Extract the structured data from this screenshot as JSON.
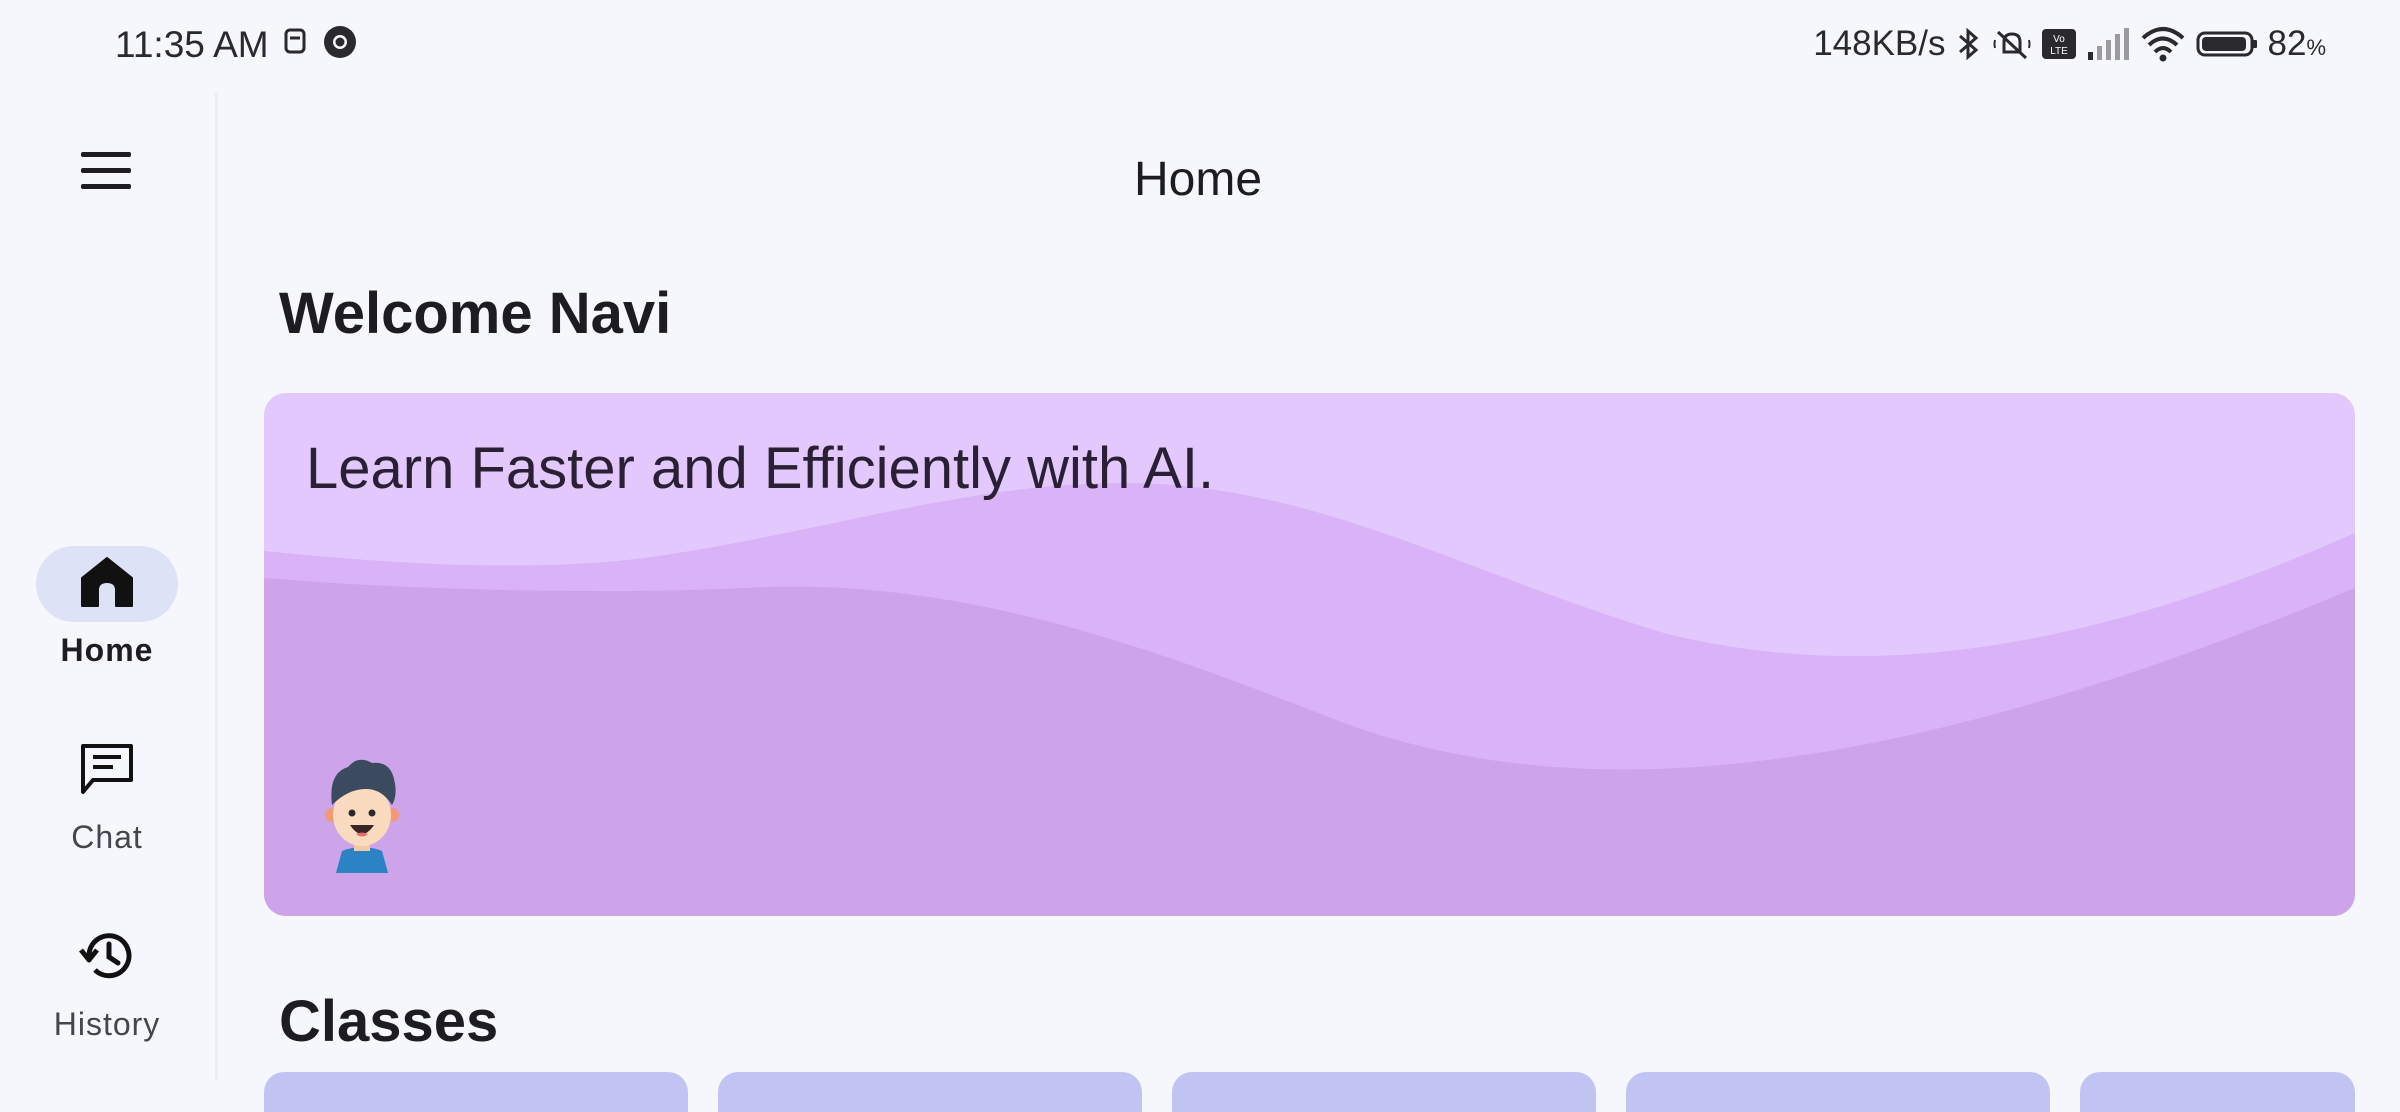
{
  "status_bar": {
    "time": "11:35 AM",
    "network_speed": "148KB/s",
    "battery_percent": "82",
    "battery_unit": "%",
    "left_icons": [
      "notification-icon",
      "chrome-icon"
    ],
    "right_icons": [
      "bluetooth-icon",
      "silent-icon",
      "volte-icon",
      "signal-icon",
      "wifi-icon",
      "battery-icon"
    ]
  },
  "nav_rail": {
    "menu_icon": "hamburger-menu-icon",
    "items": [
      {
        "label": "Home",
        "icon": "home-icon",
        "active": true
      },
      {
        "label": "Chat",
        "icon": "chat-icon",
        "active": false
      },
      {
        "label": "History",
        "icon": "history-icon",
        "active": false
      }
    ]
  },
  "app_bar": {
    "title": "Home"
  },
  "welcome": {
    "text": "Welcome Navi"
  },
  "hero": {
    "text": "Learn Faster and Efficiently with AI.",
    "colors": {
      "light": "#e3c8fd",
      "mid": "#d9b2f8",
      "dark": "#cda3e9"
    },
    "avatar_icon": "boy-avatar-icon"
  },
  "classes": {
    "title": "Classes",
    "card_color": "#c1c4f3"
  }
}
